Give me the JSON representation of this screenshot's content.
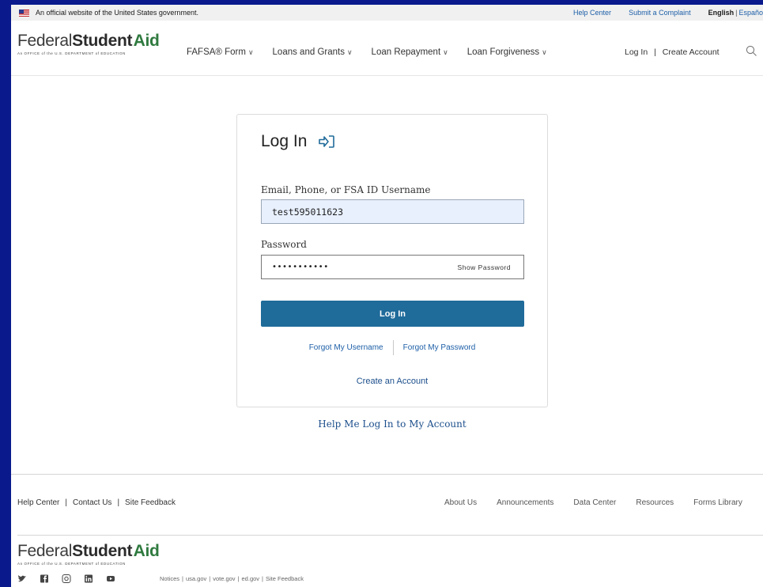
{
  "banner": {
    "official_text": "An official website of the United States government.",
    "help_center": "Help Center",
    "submit_complaint": "Submit a Complaint",
    "lang_english": "English",
    "lang_separator": "|",
    "lang_spanish": "Españo"
  },
  "header": {
    "logo_part1": "Federal",
    "logo_part2": "Student",
    "logo_part3": "Aid",
    "logo_subtitle": "An OFFICE of the U.S. DEPARTMENT of EDUCATION",
    "nav": [
      {
        "label": "FAFSA® Form"
      },
      {
        "label": "Loans and Grants"
      },
      {
        "label": "Loan Repayment"
      },
      {
        "label": "Loan Forgiveness"
      }
    ],
    "login": "Log In",
    "account_separator": "|",
    "create_account": "Create Account"
  },
  "login": {
    "title": "Log In",
    "username_label": "Email, Phone, or FSA ID Username",
    "username_value": "test595011623",
    "password_label": "Password",
    "password_value": "•••••••••••",
    "show_password": "Show Password",
    "submit": "Log In",
    "forgot_username": "Forgot My Username",
    "forgot_password": "Forgot My Password",
    "create_account": "Create an Account",
    "help": "Help Me Log In to My Account"
  },
  "footer": {
    "left_links": [
      "Help Center",
      "Contact Us",
      "Site Feedback"
    ],
    "right_links": [
      "About Us",
      "Announcements",
      "Data Center",
      "Resources",
      "Forms Library"
    ],
    "legal_links": [
      "Notices",
      "usa.gov",
      "vote.gov",
      "ed.gov",
      "Site Feedback"
    ],
    "social_icons": [
      "twitter-icon",
      "facebook-icon",
      "instagram-icon",
      "linkedin-icon",
      "youtube-icon"
    ]
  },
  "colors": {
    "primary_button": "#1f6b9a",
    "link": "#1d5fa8",
    "brand_green": "#2f7a3f",
    "outer_background": "#0a1a8c"
  }
}
